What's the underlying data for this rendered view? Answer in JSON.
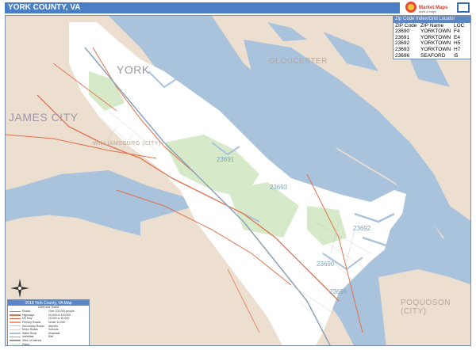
{
  "title": "YORK COUNTY, VA",
  "brand": {
    "name": "Market Maps",
    "sub": "world of maps"
  },
  "places": [
    {
      "id": "york",
      "label": "YORK",
      "size": "large"
    },
    {
      "id": "gloucester",
      "label": "GLOUCESTER",
      "size": "small"
    },
    {
      "id": "james-city",
      "label": "JAMES CITY",
      "size": "large"
    },
    {
      "id": "williamsburg",
      "label": "WILLIAMSBURG (CITY)",
      "size": "small"
    },
    {
      "id": "poquoson",
      "label": "POQUOSON (CITY)",
      "size": "small"
    }
  ],
  "zip_labels": [
    "23691",
    "23692",
    "23693",
    "23690",
    "23696"
  ],
  "zip_table": {
    "caption": "Zip Code Index/Grid Locator",
    "headers": [
      "ZIP Code",
      "ZIP Name",
      "LOC"
    ],
    "rows": [
      [
        "23690",
        "YORKTOWN",
        "F4"
      ],
      [
        "23691",
        "YORKTOWN",
        "E4"
      ],
      [
        "23692",
        "YORKTOWN",
        "H5"
      ],
      [
        "23693",
        "YORKTOWN",
        "H7"
      ],
      [
        "23696",
        "SEAFORD",
        "I5"
      ]
    ]
  },
  "legend": {
    "title": "2018 York County, VA Map",
    "subtitle": "Cities and Towns",
    "left_items": [
      "Roads",
      "Highways",
      "US Hwy",
      "Primary Roads",
      "Secondary Roads",
      "Minor Roads",
      "Water Body",
      "Interstate",
      "Sites of Interest",
      "Parks"
    ],
    "right_items": [
      "Over 100,000 people",
      "50,000 to 100,000",
      "25,000 to 50,000",
      "Under 10,000",
      "Airports",
      "Schools",
      "Hospitals",
      "Rail"
    ]
  },
  "colors": {
    "water": "#a9c3dd",
    "land": "#ecdfd0",
    "county": "#ffffff",
    "park": "#d6e9c8",
    "road": "#e0714c",
    "title_bar": "#4a7fc5"
  }
}
